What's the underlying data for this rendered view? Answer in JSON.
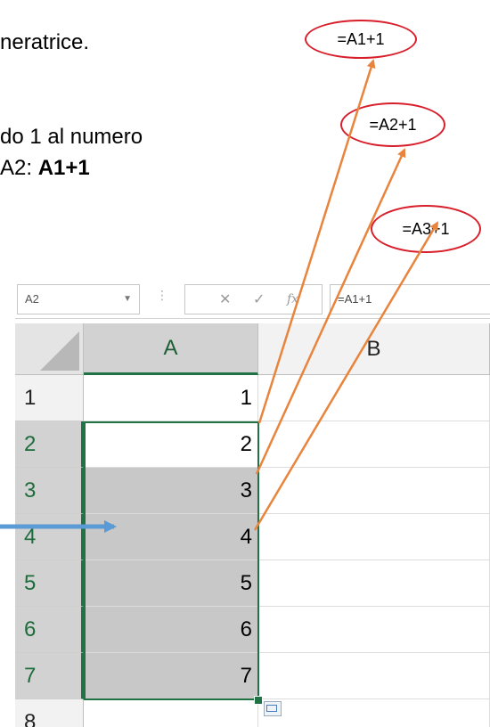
{
  "slide": {
    "line1": "neratrice.",
    "line2": "do 1 al numero",
    "line3_prefix": "A2: ",
    "line3_bold": "A1+1"
  },
  "callouts": [
    "=A1+1",
    "=A2+1",
    "=A3+1"
  ],
  "excel": {
    "name_box": "A2",
    "formula_bar": "=A1+1",
    "fx_label": "fx",
    "columns": [
      "A",
      "B"
    ],
    "rows": [
      {
        "row": "1",
        "a": "1"
      },
      {
        "row": "2",
        "a": "2"
      },
      {
        "row": "3",
        "a": "3"
      },
      {
        "row": "4",
        "a": "4"
      },
      {
        "row": "5",
        "a": "5"
      },
      {
        "row": "6",
        "a": "6"
      },
      {
        "row": "7",
        "a": "7"
      },
      {
        "row": "8",
        "a": ""
      }
    ]
  },
  "colors": {
    "callout_border": "#d81e2a",
    "arrow_orange": "#e8843c",
    "arrow_blue": "#5b9bd5",
    "excel_green": "#217346"
  }
}
